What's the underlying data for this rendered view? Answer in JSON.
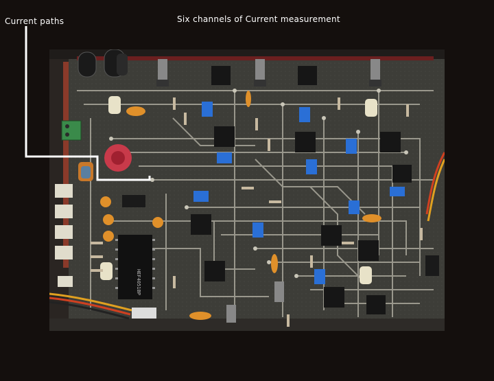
{
  "captions": {
    "top": "Six channels of Current measurement",
    "left": "Current paths"
  },
  "colors": {
    "background": "#140f0d",
    "pointer": "#ffffff",
    "board": "#3d3d38",
    "trace": "#b8b5a8"
  },
  "chips": [
    {
      "label": "HEF4051BP"
    }
  ]
}
